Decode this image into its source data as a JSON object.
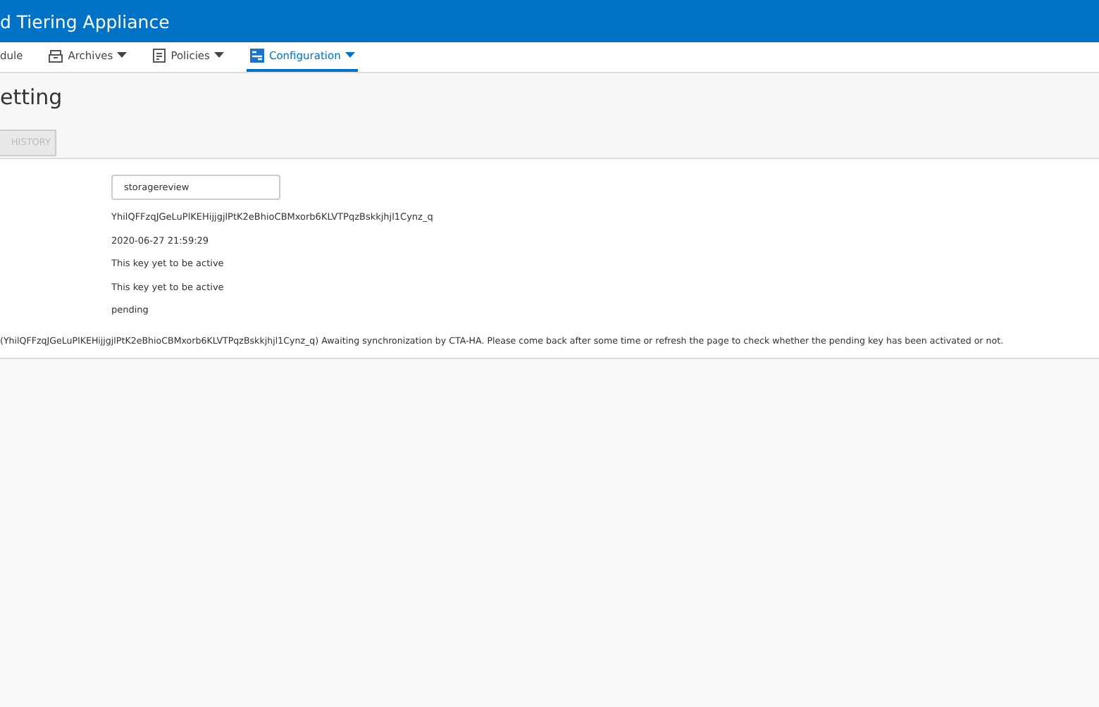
{
  "header": {
    "title": "d Tiering Appliance"
  },
  "nav": [
    {
      "label": "dule",
      "selected": false,
      "kind": "plain"
    },
    {
      "label": "Archives",
      "selected": false,
      "kind": "archive"
    },
    {
      "label": "Policies",
      "selected": false,
      "kind": "policy"
    },
    {
      "label": "Configuration",
      "selected": true,
      "kind": "config"
    }
  ],
  "page": {
    "title": "etting",
    "history_button": "HISTORY"
  },
  "form": {
    "field_value": "storagereview",
    "rows": [
      "YhilQFFzqJGeLuPlKEHijjgjlPtK2eBhioCBMxorb6KLVTPqzBskkjhjl1Cynz_q",
      "2020-06-27 21:59:29",
      "This key yet to be active",
      "This key yet to be active",
      "pending"
    ],
    "message": "(YhilQFFzqJGeLuPlKEHijjgjlPtK2eBhioCBMxorb6KLVTPqzBskkjhjl1Cynz_q) Awaiting synchronization by CTA-HA. Please come back after some time or refresh the page to check whether the pending key has been activated or not."
  }
}
